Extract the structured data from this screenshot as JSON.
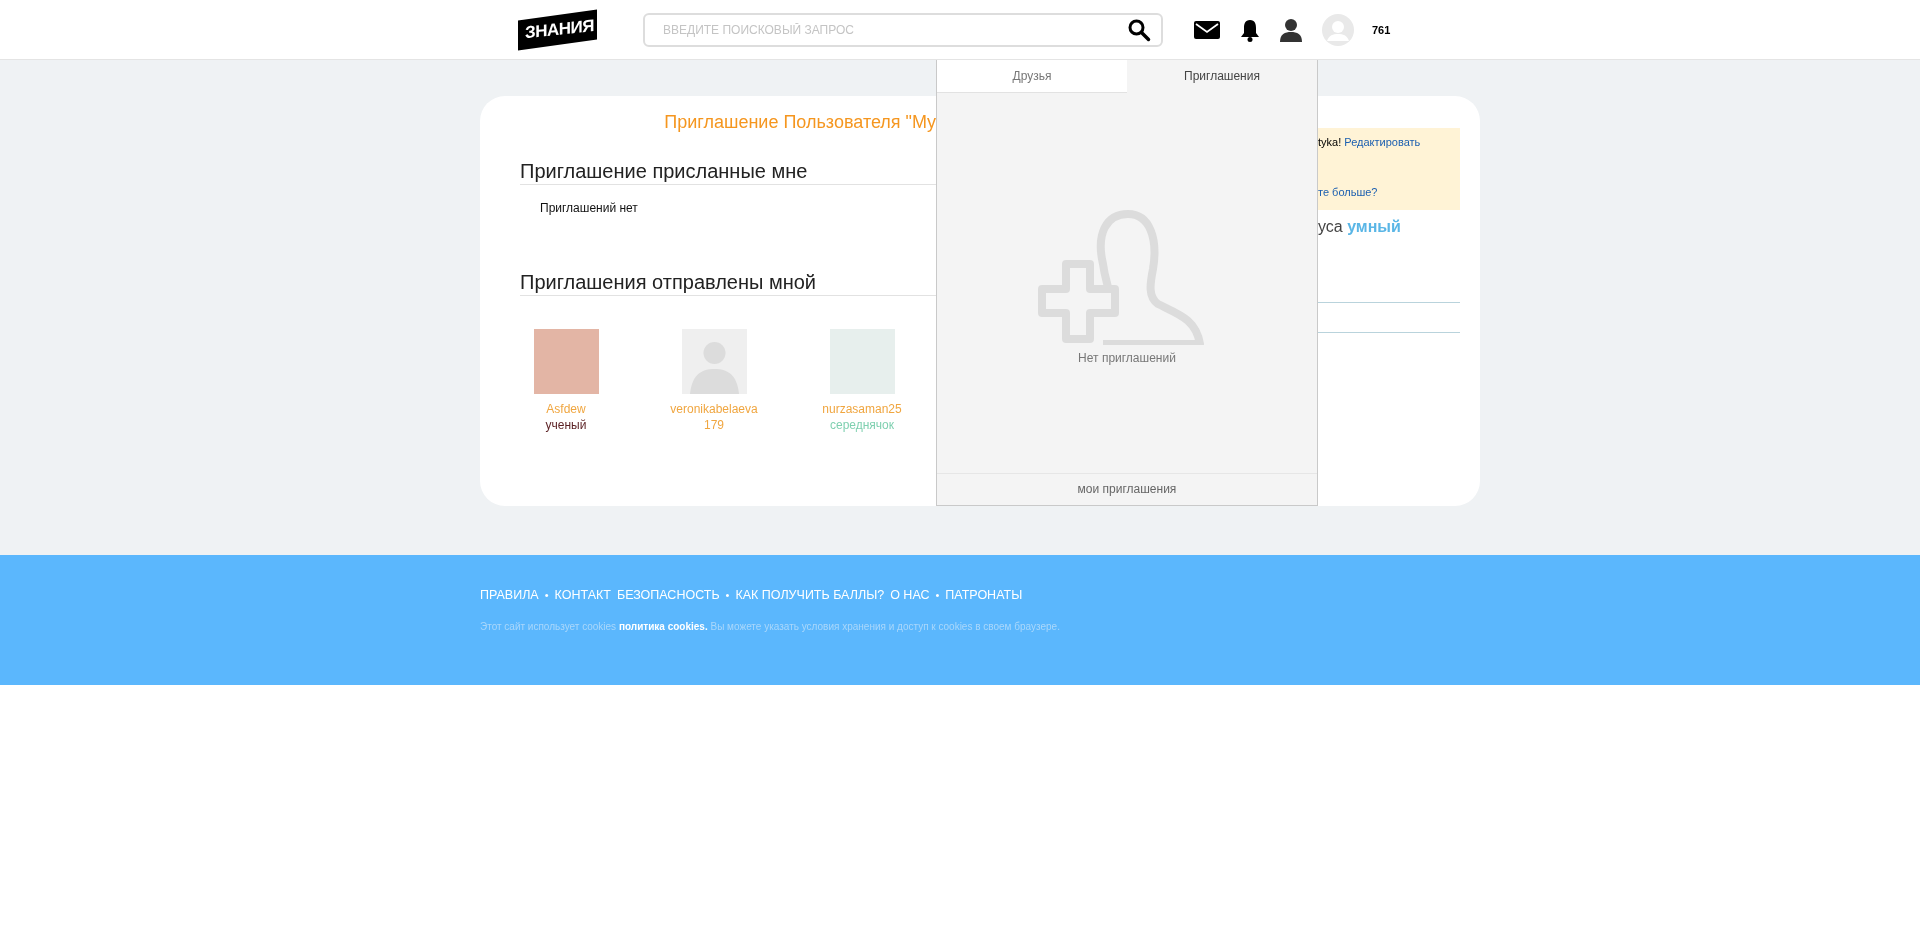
{
  "header": {
    "logo": "ЗНАНИЯ",
    "search": {
      "placeholder": "ВВЕДИТЕ ПОИСКОВЫЙ ЗАПРОС"
    },
    "points": "761"
  },
  "card": {
    "title": "Приглашение Пользователя \"My",
    "received": {
      "heading": "Приглашение присланные мне",
      "empty": "Приглашений нет"
    },
    "sent": {
      "heading": "Приглашения отправлены мной",
      "users": [
        {
          "name": "Asfdew",
          "status": {
            "text": "ученый",
            "color": "#5a1f22"
          },
          "kind": "picture",
          "color": "#e3b5a5"
        },
        {
          "name": "veronikabelaeva179",
          "kind": "default",
          "color": "#efefef"
        },
        {
          "name": "nurzasaman25",
          "status": {
            "text": "середнячок",
            "color": "#7fd0b0"
          },
          "kind": "picture",
          "color": "#e7efed"
        }
      ]
    },
    "side": {
      "notice_text": "tyka!",
      "notice_link": "Редактировать",
      "more_link": "те больше?",
      "rank_text": "уса",
      "rank_value": "умный"
    }
  },
  "dropdown": {
    "tabs": [
      {
        "label": "Друзья",
        "selected": false
      },
      {
        "label": "Приглашения",
        "selected": true
      }
    ],
    "empty": "Нет приглашений",
    "footer_link": "мои приглашения"
  },
  "footer": {
    "links": [
      {
        "kind": "link",
        "label": "ПРАВИЛА"
      },
      {
        "kind": "separator",
        "label": "•"
      },
      {
        "kind": "link",
        "label": "КОНТАКТ"
      },
      {
        "kind": "link",
        "label": "БЕЗОПАСНОСТЬ"
      },
      {
        "kind": "separator",
        "label": "•"
      },
      {
        "kind": "link",
        "label": "КАК ПОЛУЧИТЬ БАЛЛЫ?"
      },
      {
        "kind": "link",
        "label": "О НАС"
      },
      {
        "kind": "separator",
        "label": "•"
      },
      {
        "kind": "link",
        "label": "ПАТРОНАТЫ"
      }
    ],
    "cookie_before": "Этот сайт использует cookies",
    "cookie_link": "политика cookies.",
    "cookie_after": "Вы можете указать условия хранения и доступ к cookies в своем браузере."
  }
}
